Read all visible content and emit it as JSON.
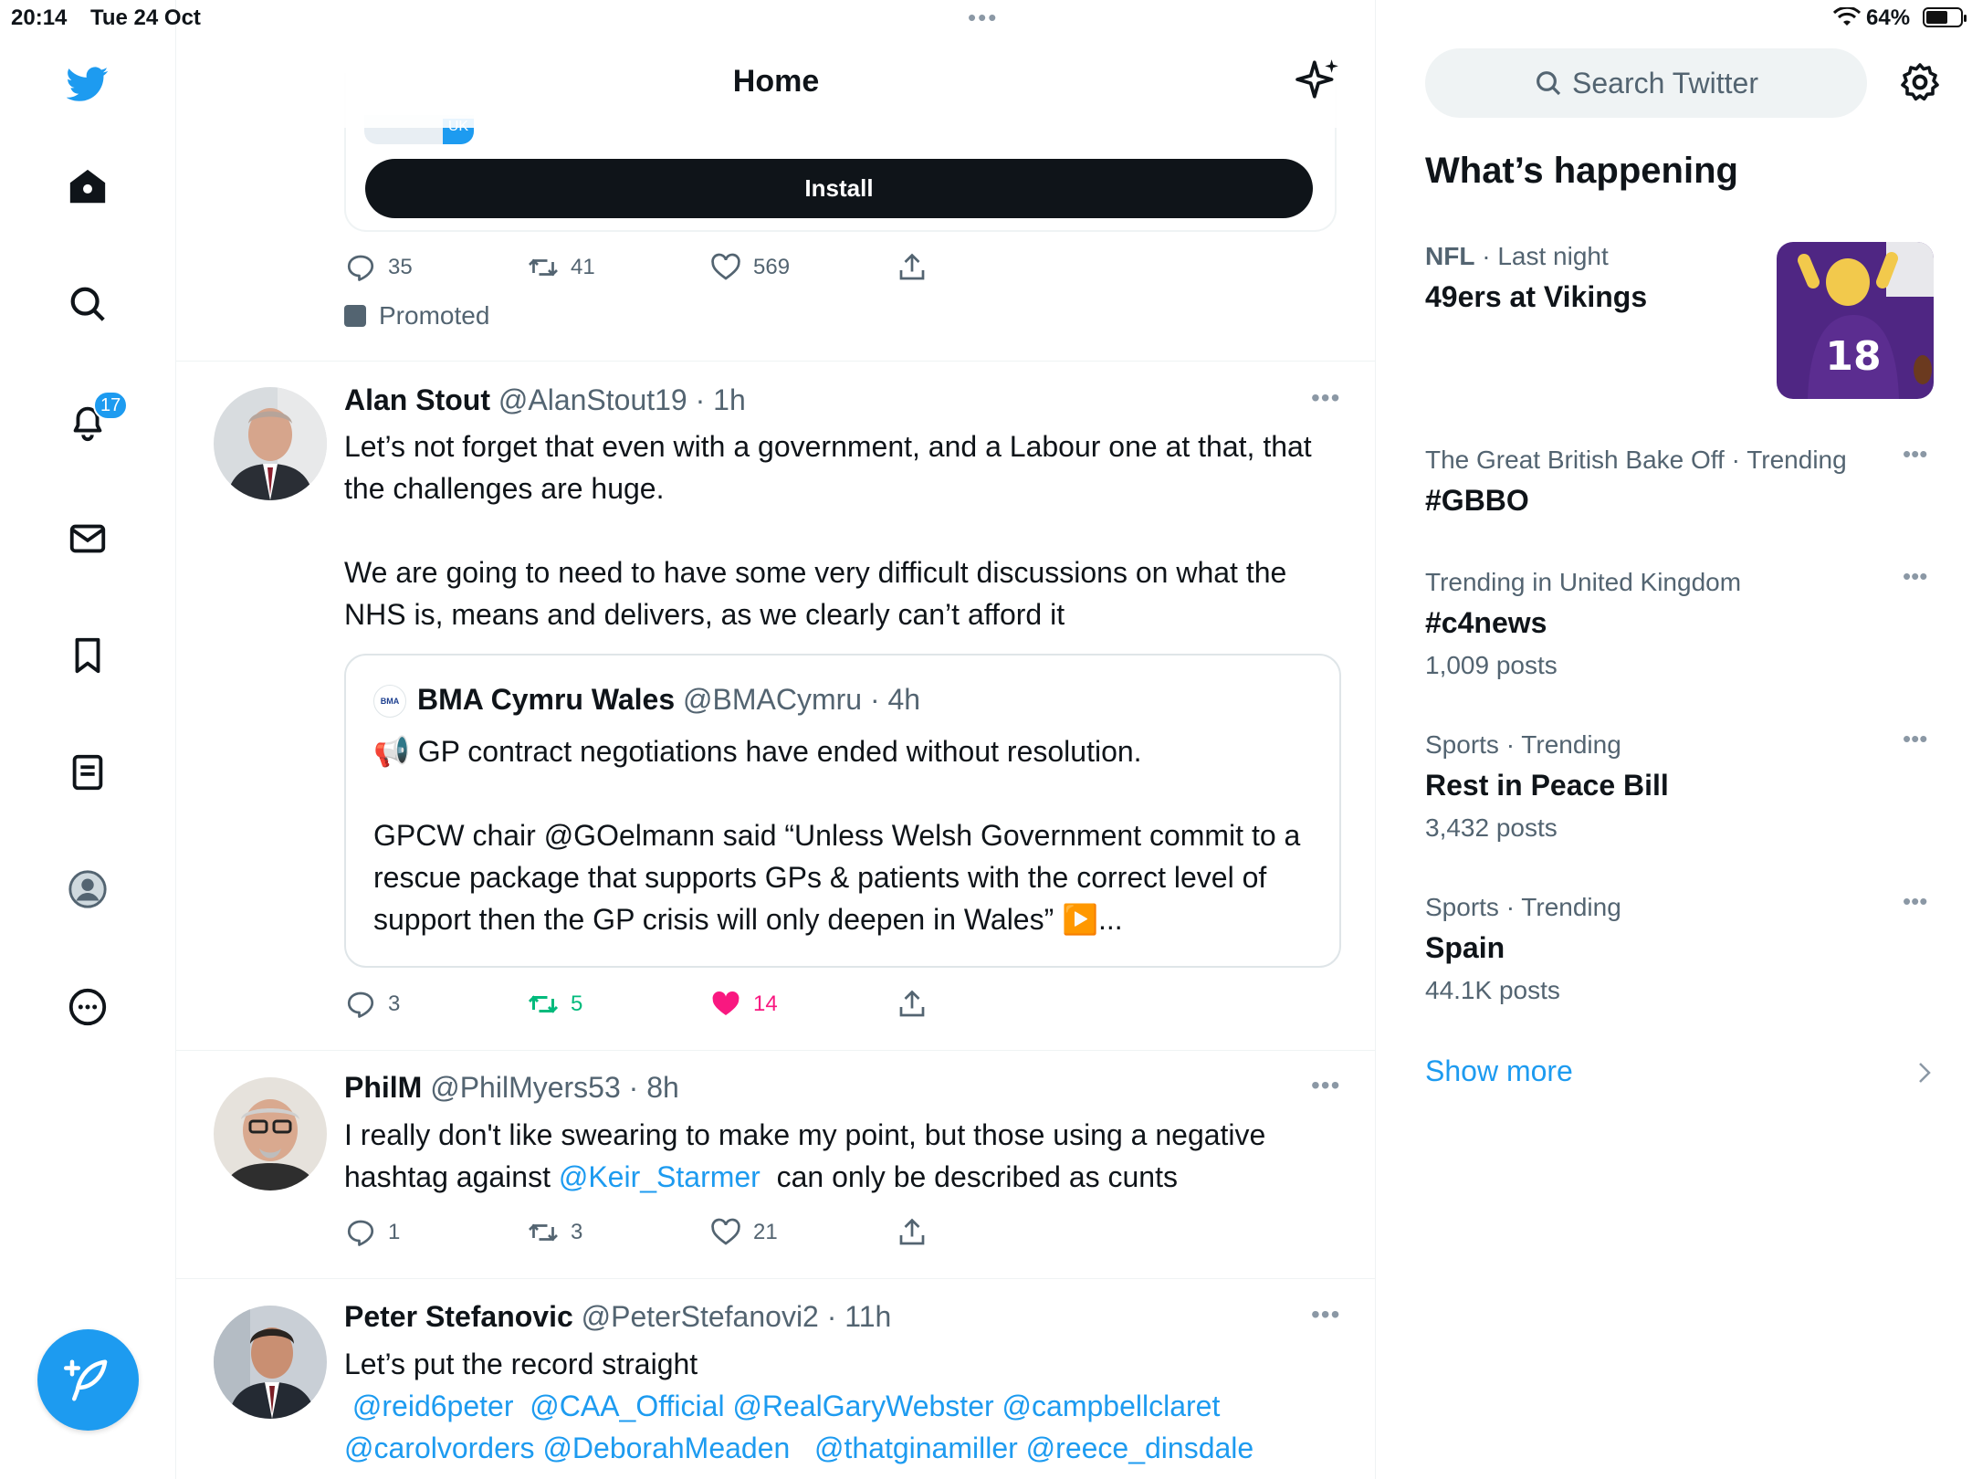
{
  "status": {
    "time": "20:14",
    "date": "Tue 24 Oct",
    "battery": "64%",
    "battery_level": 0.64
  },
  "nav": {
    "notifications_badge": "17"
  },
  "header": {
    "title": "Home"
  },
  "ad": {
    "badge_tag": "UK",
    "install_label": "Install",
    "replies": "35",
    "retweets": "41",
    "likes": "569",
    "promoted_label": "Promoted"
  },
  "tweets": [
    {
      "name": "Alan Stout",
      "handle": "@AlanStout19 · 1h",
      "text": "Let’s not forget that even with a government, and a Labour one at that, that the challenges are huge.\n\nWe are going to need to have some very difficult discussions on what the NHS is, means and delivers, as we clearly can’t afford it",
      "quote": {
        "avatar_text": "BMA",
        "name": "BMA Cymru Wales",
        "handle": "@BMACymru · 4h",
        "text": "📢 GP contract negotiations have ended without resolution.\n\nGPCW chair @GOelmann said “Unless Welsh Government commit to a rescue package that supports GPs & patients with the correct level of support then the GP crisis will only deepen in Wales” ▶️..."
      },
      "replies": "3",
      "retweets": "5",
      "likes": "14"
    },
    {
      "name": "PhilM",
      "handle": "@PhilMyers53 · 8h",
      "text_before": "I really don't like swearing to make my point, but those using a negative hashtag against ",
      "mention": "@Keir_Starmer",
      "text_after": "  can only be described as cunts",
      "replies": "1",
      "retweets": "3",
      "likes": "21"
    },
    {
      "name": "Peter Stefanovic",
      "handle": "@PeterStefanovi2 · 11h",
      "text": "Let’s put the record straight",
      "mentions_line1": " @reid6peter  @CAA_Official @RealGaryWebster @campbellclaret",
      "mentions_line2": "@carolvorders @DeborahMeaden   @thatginamiller @reece_dinsdale"
    }
  ],
  "right": {
    "search_placeholder": "Search Twitter",
    "section_title": "What’s happening",
    "trends": [
      {
        "meta_bold": "NFL",
        "meta": " · Last night",
        "title": "49ers at Vikings",
        "count": ""
      },
      {
        "meta_bold": "",
        "meta": "The Great British Bake Off · Trending",
        "title": "#GBBO",
        "count": ""
      },
      {
        "meta_bold": "",
        "meta": "Trending in United Kingdom",
        "title": "#c4news",
        "count": "1,009 posts"
      },
      {
        "meta_bold": "",
        "meta": "Sports · Trending",
        "title": "Rest in Peace Bill",
        "count": "3,432 posts"
      },
      {
        "meta_bold": "",
        "meta": "Sports · Trending",
        "title": "Spain",
        "count": "44.1K posts"
      }
    ],
    "trend_image_number": "18",
    "show_more": "Show more"
  },
  "colors": {
    "accent": "#1d9bf0",
    "like": "#f91880",
    "retweet": "#00ba7c",
    "text": "#0f1419",
    "muted": "#536471"
  },
  "icons": [
    "twitter-logo-icon",
    "home-icon",
    "search-icon",
    "bell-icon",
    "mail-icon",
    "bookmark-icon",
    "lists-icon",
    "profile-icon",
    "more-icon",
    "compose-icon",
    "sparkle-icon",
    "reply-icon",
    "retweet-icon",
    "like-icon",
    "share-icon",
    "gear-icon",
    "chevron-right-icon"
  ]
}
